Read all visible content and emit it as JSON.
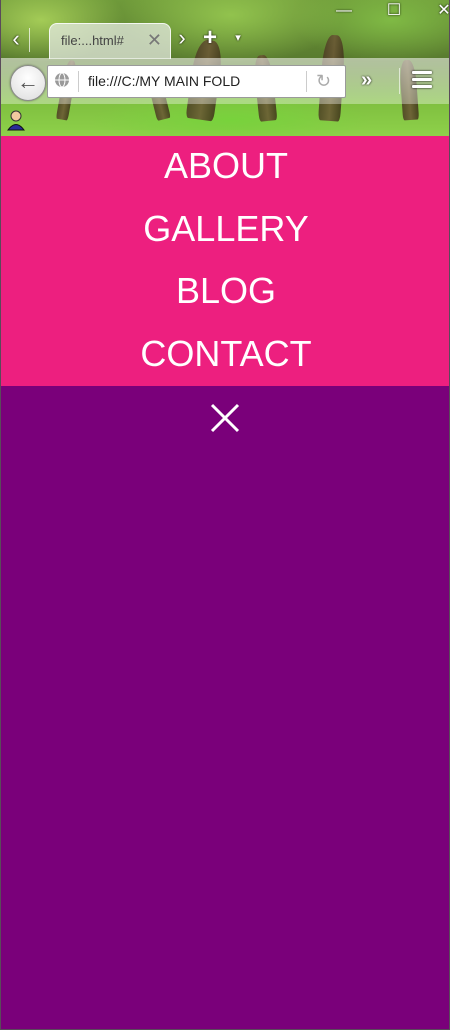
{
  "browser": {
    "tab": {
      "title": "file:...html#",
      "close_glyph": "✕"
    },
    "tab_strip": {
      "scroll_left_glyph": "‹",
      "scroll_right_glyph": "›",
      "new_tab_glyph": "+",
      "list_tabs_glyph": "▾"
    },
    "window_controls": {
      "minimize_glyph": "—",
      "maximize_glyph": "☐",
      "close_glyph": "✕"
    },
    "address_bar": {
      "url": "file:///C:/MY MAIN FOLD",
      "reload_glyph": "↻"
    },
    "toolbar": {
      "back_glyph": "←",
      "overflow_glyph": "»"
    }
  },
  "page": {
    "menu_background": "#ed1f7f",
    "page_background": "#7a007a",
    "nav_links": [
      {
        "label": "ABOUT"
      },
      {
        "label": "GALLERY"
      },
      {
        "label": "BLOG"
      },
      {
        "label": "CONTACT"
      }
    ]
  }
}
